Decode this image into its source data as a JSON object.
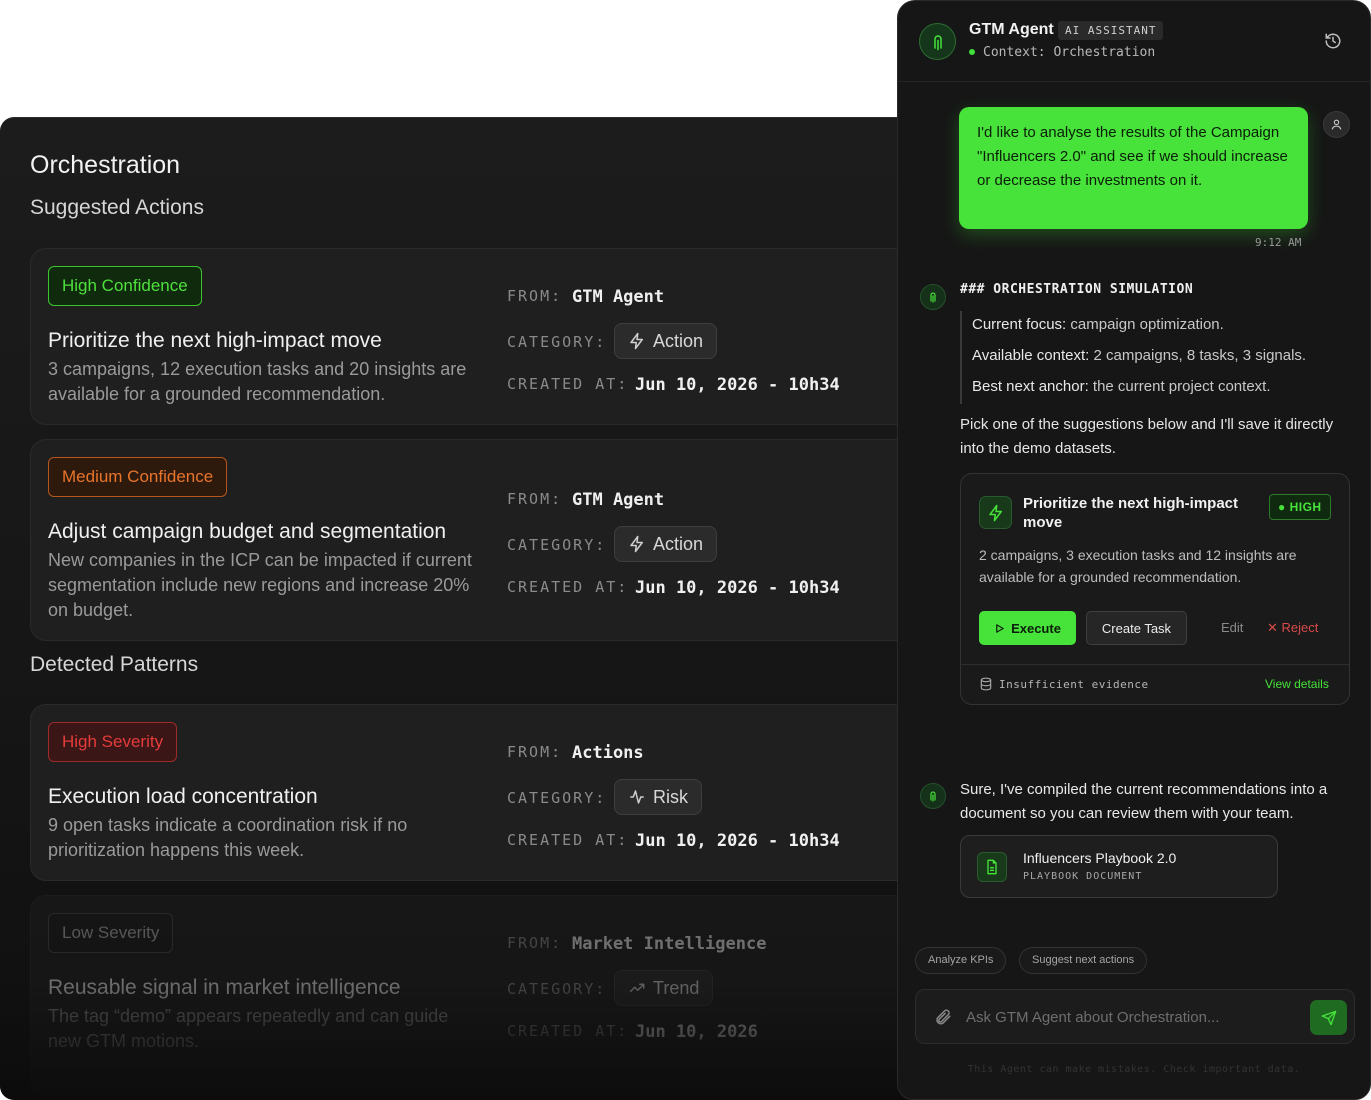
{
  "main": {
    "title": "Orchestration",
    "suggested_title": "Suggested Actions",
    "patterns_title": "Detected Patterns",
    "meta_labels": {
      "from": "FROM:",
      "category": "CATEGORY:",
      "created": "CREATED AT:"
    },
    "suggested": [
      {
        "badge": "High Confidence",
        "title": "Prioritize the next high-impact move",
        "desc": "3 campaigns, 12 execution tasks and 20 insights are available for a grounded recommendation.",
        "from": "GTM Agent",
        "category": "Action",
        "created": "Jun 10, 2026 - 10h34"
      },
      {
        "badge": "Medium Confidence",
        "title": "Adjust campaign budget and segmentation",
        "desc": "New companies in the ICP can be impacted if current segmentation include new regions and increase 20% on budget.",
        "from": "GTM Agent",
        "category": "Action",
        "created": "Jun 10, 2026 - 10h34"
      }
    ],
    "patterns": [
      {
        "badge": "High Severity",
        "title": "Execution load concentration",
        "desc": "9 open tasks indicate a coordination risk if no prioritization happens this week.",
        "from": "Actions",
        "category": "Risk",
        "created": "Jun 10, 2026 - 10h34"
      },
      {
        "badge": "Low Severity",
        "title": "Reusable signal in market intelligence",
        "desc": "The tag “demo” appears repeatedly and can guide new GTM motions.",
        "from": "Market Intelligence",
        "category": "Trend",
        "created": "Jun 10, 2026"
      }
    ]
  },
  "chat": {
    "agent_name": "GTM Agent",
    "agent_tag": "AI ASSISTANT",
    "context": "Context: Orchestration",
    "user_message": "I'd like to analyse the results of the Campaign \"Influencers 2.0\" and see if we should increase or decrease the investments on it.",
    "user_time": "9:12 AM",
    "sim_heading": "### ORCHESTRATION SIMULATION",
    "sim_rows": [
      {
        "label": "Current focus:",
        "value": "campaign optimization."
      },
      {
        "label": "Available context:",
        "value": "2 campaigns, 8 tasks, 3 signals."
      },
      {
        "label": "Best next anchor:",
        "value": "the current project context."
      }
    ],
    "pick_text": "Pick one of the suggestions below and I'll save it directly into the demo datasets.",
    "suggestion": {
      "title": "Prioritize the next high-impact move",
      "level": "HIGH",
      "desc": "2 campaigns, 3 execution tasks and 12 insights are available for a grounded recommendation.",
      "execute": "Execute",
      "create_task": "Create Task",
      "edit": "Edit",
      "reject": "Reject",
      "evidence": "Insufficient evidence",
      "view_details": "View details"
    },
    "reply_text": "Sure, I've compiled the current recommendations into a document so you can review them with your team.",
    "doc": {
      "title": "Influencers Playbook 2.0",
      "subtitle": "PLAYBOOK DOCUMENT"
    },
    "chips": [
      "Analyze KPIs",
      "Suggest next actions"
    ],
    "input_placeholder": "Ask GTM Agent about Orchestration...",
    "disclaimer": "This Agent can make mistakes. Check important data."
  },
  "colors": {
    "accent": "#47e23a",
    "panel_bg": "#161616",
    "orange": "#e8742a",
    "red": "#e53b3b"
  },
  "icons": [
    "agent-logo-icon",
    "history-icon",
    "user-icon",
    "lightning-icon",
    "activity-icon",
    "trend-icon",
    "play-icon",
    "x-icon",
    "database-icon",
    "document-icon",
    "paperclip-icon",
    "send-icon"
  ]
}
